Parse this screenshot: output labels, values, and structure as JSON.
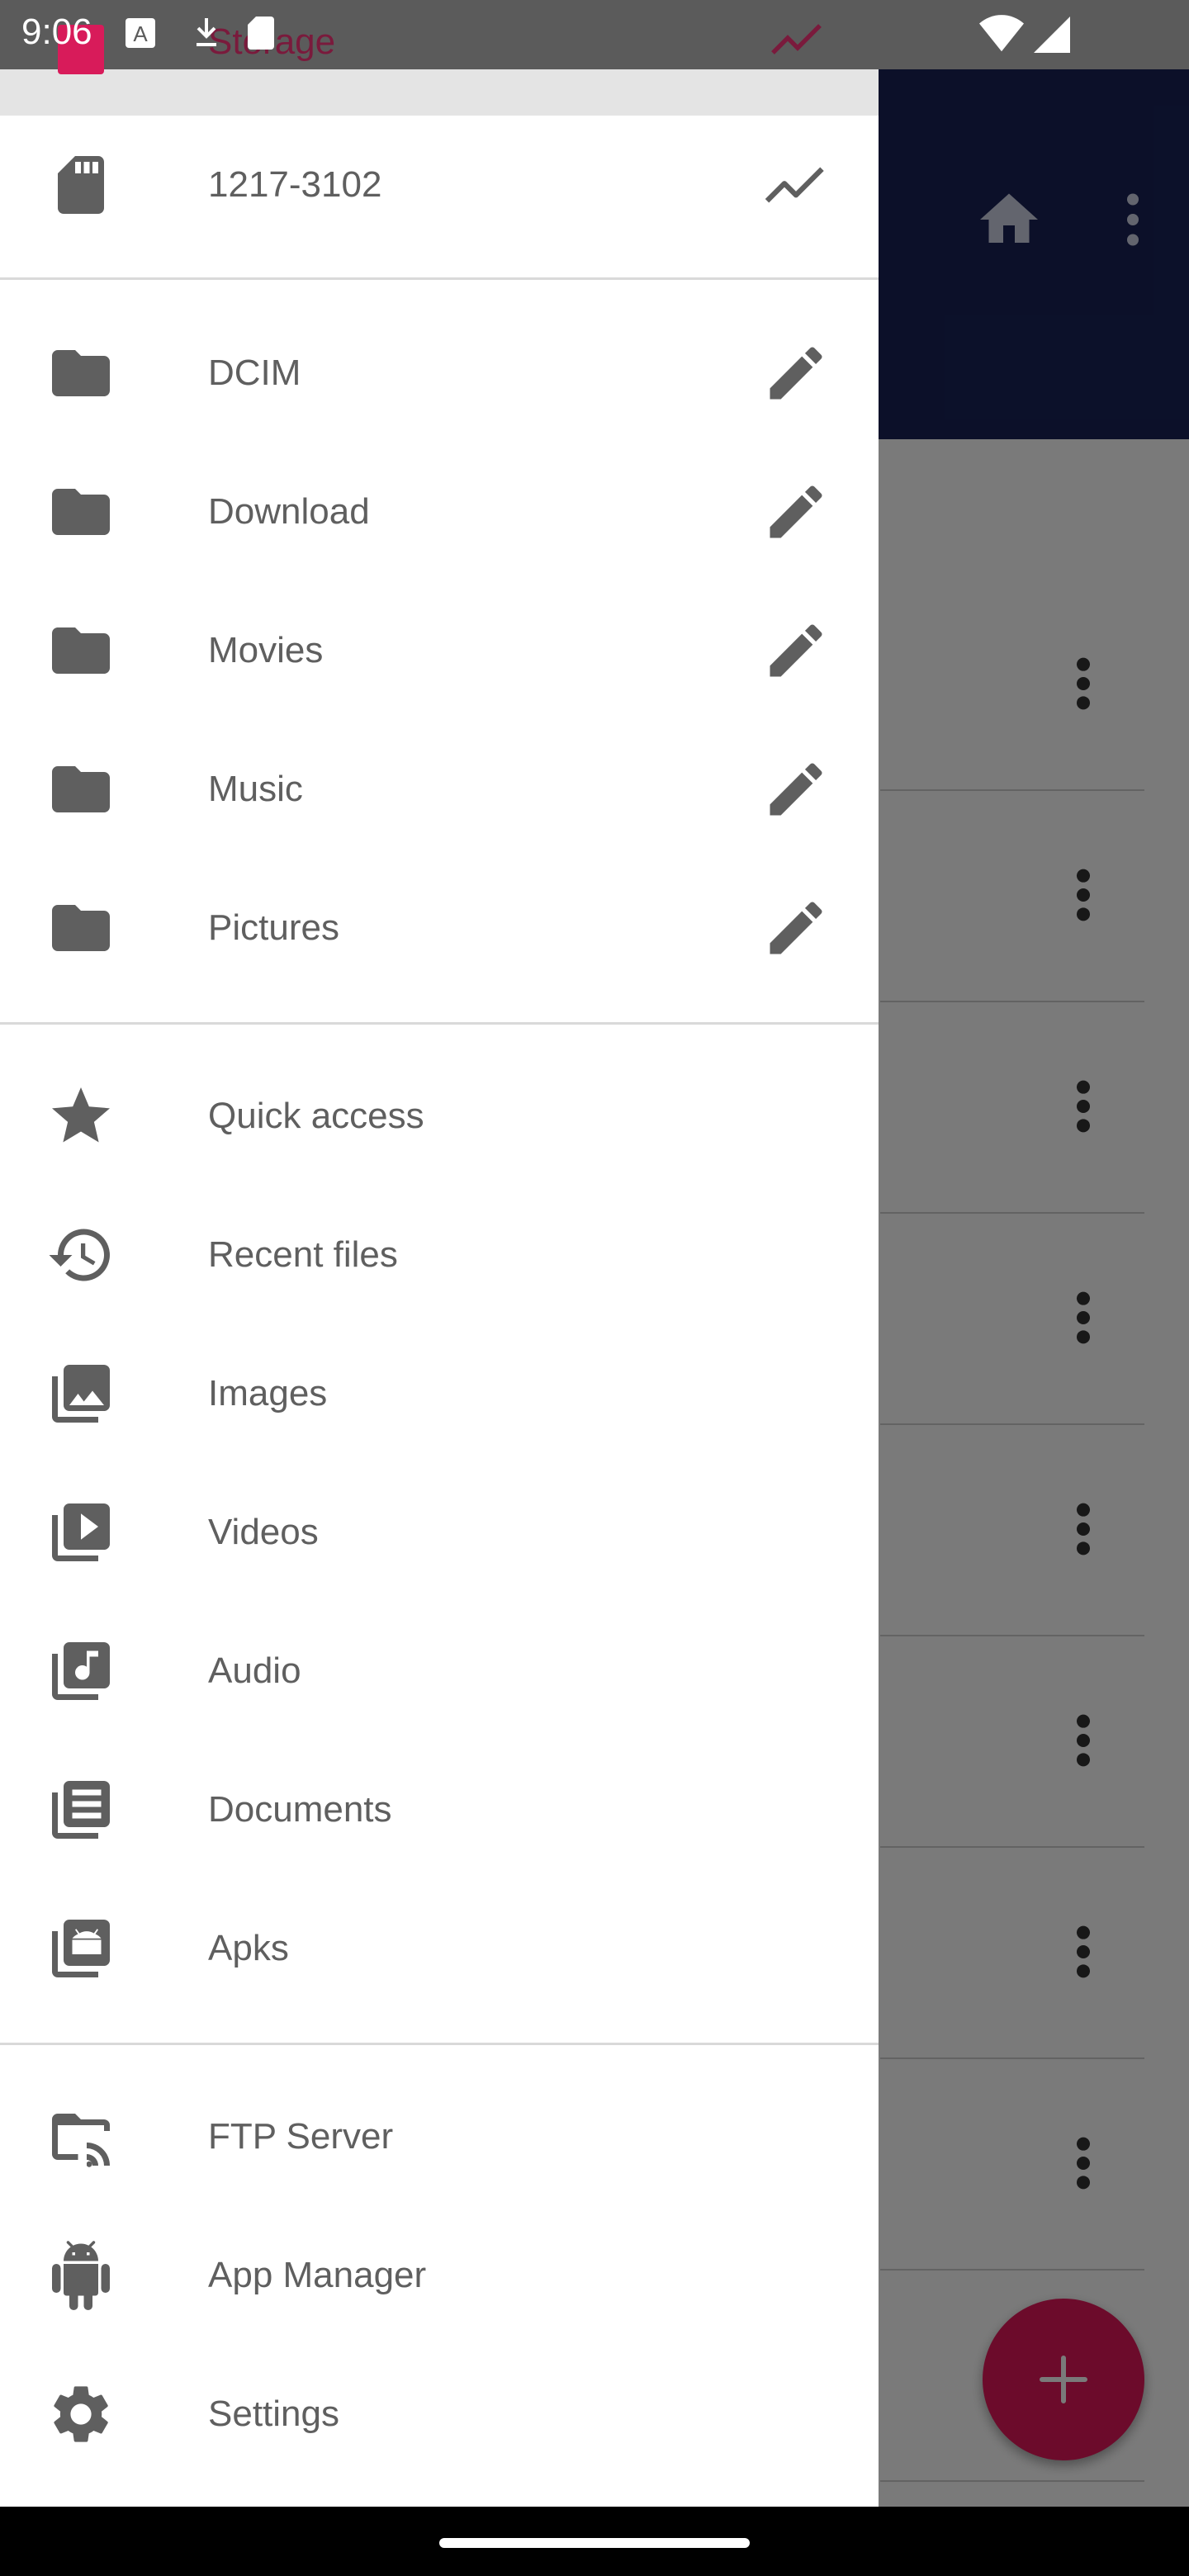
{
  "status_bar": {
    "time": "9:06"
  },
  "drawer": {
    "header_ghost_label": "Storage",
    "storage": {
      "label": "1217-3102"
    },
    "folders": [
      {
        "label": "DCIM"
      },
      {
        "label": "Download"
      },
      {
        "label": "Movies"
      },
      {
        "label": "Music"
      },
      {
        "label": "Pictures"
      }
    ],
    "categories": [
      {
        "label": "Quick access",
        "icon": "star-icon"
      },
      {
        "label": "Recent files",
        "icon": "history-icon"
      },
      {
        "label": "Images",
        "icon": "images-icon"
      },
      {
        "label": "Videos",
        "icon": "videos-icon"
      },
      {
        "label": "Audio",
        "icon": "audio-icon"
      },
      {
        "label": "Documents",
        "icon": "documents-icon"
      },
      {
        "label": "Apks",
        "icon": "apks-icon"
      }
    ],
    "tools": [
      {
        "label": "FTP Server",
        "icon": "ftp-server-icon"
      },
      {
        "label": "App Manager",
        "icon": "android-icon"
      },
      {
        "label": "Settings",
        "icon": "settings-icon"
      }
    ]
  },
  "colors": {
    "toolbar": "#1a2357",
    "accent": "#e2185b",
    "icon": "#5f5f5f",
    "label": "#5f5f5f"
  }
}
